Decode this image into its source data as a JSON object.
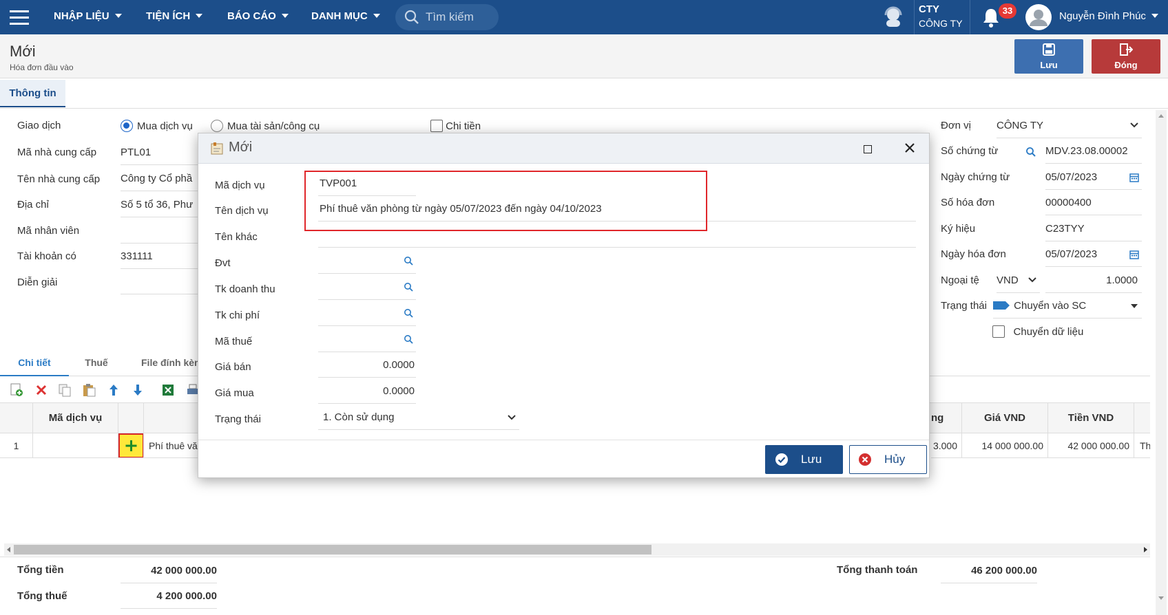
{
  "topbar": {
    "menus": [
      {
        "label": "NHẬP LIỆU"
      },
      {
        "label": "TIỆN ÍCH"
      },
      {
        "label": "BÁO CÁO"
      },
      {
        "label": "DANH MỤC"
      }
    ],
    "search_placeholder": "Tìm kiếm",
    "company_short": "CTY",
    "company_name": "CÔNG TY",
    "notification_count": "33",
    "user_name": "Nguyễn Đình Phúc",
    "accent_color": "#1c4e8a"
  },
  "page": {
    "title": "Mới",
    "subtitle": "Hóa đơn đầu vào",
    "save_label": "Lưu",
    "close_label": "Đóng",
    "tab_info": "Thông tin"
  },
  "form_left": {
    "transaction_label": "Giao dịch",
    "transaction_options": [
      "Mua dịch vụ",
      "Mua tài sản/công cụ"
    ],
    "transaction_selected": "Mua dịch vụ",
    "pay_cash_label": "Chi tiền",
    "supplier_code_label": "Mã nhà cung cấp",
    "supplier_code": "PTL01",
    "supplier_name_label": "Tên nhà cung cấp",
    "supplier_name": "Công ty Cổ phầ",
    "address_label": "Địa chỉ",
    "address": "Số 5 tổ 36, Phư",
    "employee_label": "Mã nhân viên",
    "employee": "",
    "credit_account_label": "Tài khoản có",
    "credit_account": "331111",
    "description_label": "Diễn giải",
    "description": ""
  },
  "form_right": {
    "unit_label": "Đơn vị",
    "unit": "CÔNG TY",
    "voucher_no_label": "Số chứng từ",
    "voucher_no": "MDV.23.08.00002",
    "voucher_date_label": "Ngày chứng từ",
    "voucher_date": "05/07/2023",
    "invoice_no_label": "Số hóa đơn",
    "invoice_no": "00000400",
    "symbol_label": "Ký hiệu",
    "symbol": "C23TYY",
    "invoice_date_label": "Ngày hóa đơn",
    "invoice_date": "05/07/2023",
    "currency_label": "Ngoại tệ",
    "currency": "VND",
    "rate": "1.0000",
    "status_label": "Trạng thái",
    "status": "Chuyển vào SC",
    "transfer_label": "Chuyển dữ liệu"
  },
  "detail": {
    "tabs": [
      "Chi tiết",
      "Thuế",
      "File đính kèm"
    ],
    "columns": [
      "Mã dịch vụ",
      "ng",
      "Giá VND",
      "Tiền VND"
    ],
    "rows": [
      {
        "no": "1",
        "code": "",
        "name": "Phí thuê vă",
        "qty": "3.000",
        "price": "14 000 000.00",
        "amount": "42 000 000.00",
        "extra": "Th"
      }
    ]
  },
  "totals": {
    "total_label": "Tổng tiền",
    "total": "42 000 000.00",
    "tax_label": "Tổng thuế",
    "tax": "4 200 000.00",
    "payment_label": "Tổng thanh toán",
    "payment": "46 200 000.00"
  },
  "modal": {
    "title": "Mới",
    "service_code_label": "Mã dịch vụ",
    "service_code": "TVP001",
    "service_name_label": "Tên dịch vụ",
    "service_name": "Phí thuê văn phòng từ ngày 05/07/2023 đến ngày 04/10/2023",
    "other_name_label": "Tên khác",
    "other_name": "",
    "unit_label": "Đvt",
    "revenue_account_label": "Tk doanh thu",
    "expense_account_label": "Tk chi phí",
    "tax_code_label": "Mã thuế",
    "sale_price_label": "Giá bán",
    "sale_price": "0.0000",
    "purchase_price_label": "Giá mua",
    "purchase_price": "0.0000",
    "status_label": "Trạng thái",
    "status": "1. Còn sử dụng",
    "save_label": "Lưu",
    "cancel_label": "Hủy"
  }
}
